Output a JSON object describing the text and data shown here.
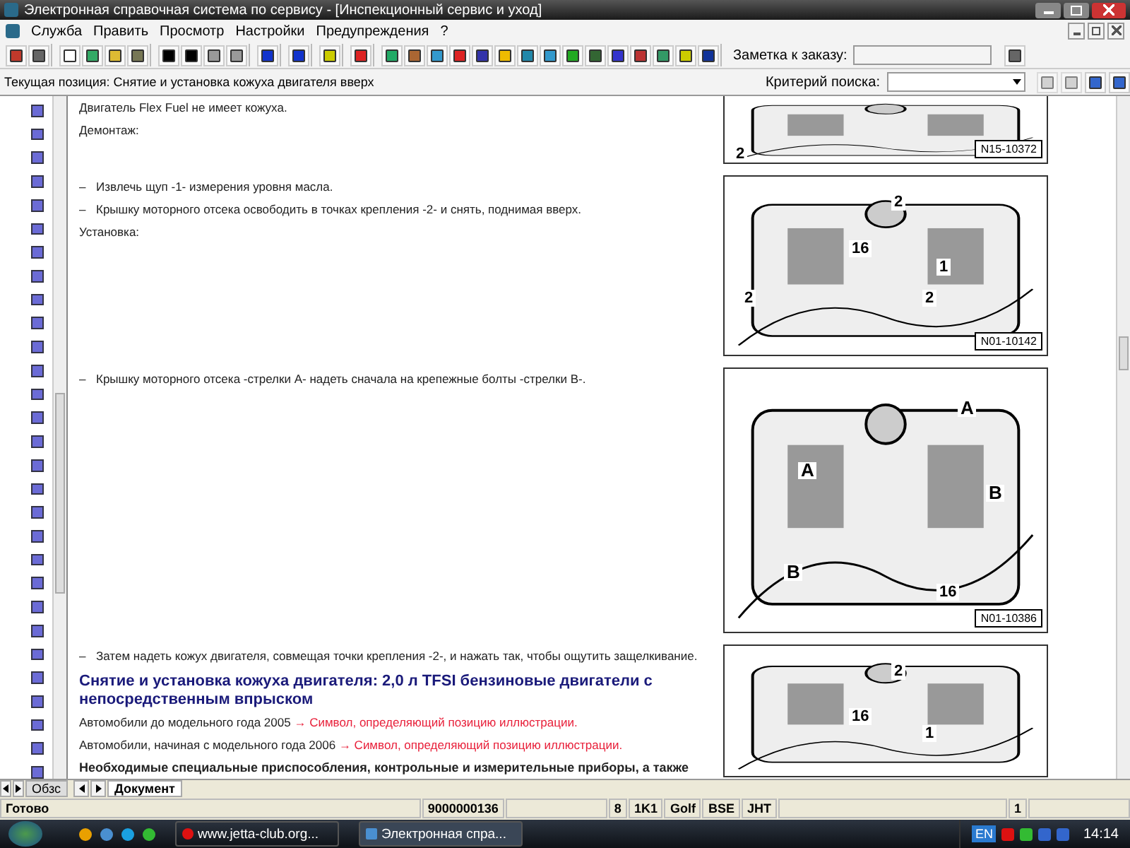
{
  "window": {
    "title": "Электронная справочная система по сервису - [Инспекционный сервис и уход]"
  },
  "menu": [
    "Служба",
    "Править",
    "Просмотр",
    "Настройки",
    "Предупреждения",
    "?"
  ],
  "order_note": {
    "label": "Заметка к заказу:"
  },
  "position": "Текущая позиция: Снятие и установка кожуха двигателя вверх",
  "search": {
    "label": "Критерий поиска:"
  },
  "sections": [
    {
      "blocks": [
        {
          "kind": "text",
          "text": "Двигатель Flex Fuel не имеет кожуха."
        },
        {
          "kind": "text",
          "text": "Демонтаж:"
        }
      ],
      "figure": {
        "code": "N15-10372",
        "callouts": [
          "2"
        ]
      }
    },
    {
      "blocks": [
        {
          "kind": "step",
          "bullet": "–",
          "text": "Извлечь щуп -1- измерения уровня масла."
        },
        {
          "kind": "step",
          "bullet": "–",
          "text": "Крышку моторного отсека освободить в точках крепления -2- и снять, поднимая вверх."
        },
        {
          "kind": "text",
          "text": "Установка:"
        }
      ],
      "figure": {
        "code": "N01-10142",
        "callouts": [
          "2",
          "1",
          "2",
          "2",
          "16"
        ]
      }
    },
    {
      "blocks": [
        {
          "kind": "step",
          "bullet": "–",
          "text": "Крышку моторного отсека -стрелки А- надеть сначала на крепежные болты -стрелки В-."
        }
      ],
      "figure": {
        "code": "N01-10386",
        "callouts": [
          "A",
          "A",
          "B",
          "B",
          "16"
        ]
      }
    },
    {
      "blocks": [
        {
          "kind": "step",
          "bullet": "–",
          "text": "Затем надеть кожух двигателя, совмещая точки крепления -2-, и нажать так, чтобы ощутить защелкивание."
        },
        {
          "kind": "heading",
          "text": "Снятие и установка кожуха двигателя: 2,0 л TFSI бензиновые двигатели с непосредственным впрыском"
        },
        {
          "kind": "link",
          "text": "Автомобили до модельного года 2005",
          "link": "→ Символ, определяющий позицию иллюстрации."
        },
        {
          "kind": "link",
          "text": "Автомобили, начиная с модельного года 2006",
          "link": "→ Символ, определяющий позицию иллюстрации."
        },
        {
          "kind": "bold",
          "text": "Необходимые специальные приспособления, контрольные и измерительные приборы, а также"
        }
      ],
      "figure": {
        "callouts": [
          "2",
          "1",
          "16"
        ]
      }
    }
  ],
  "tabs": [
    {
      "label": "Обзс",
      "selected": false
    },
    {
      "label": "Документ",
      "selected": true
    }
  ],
  "status_bar": {
    "text": "Готово",
    "order": "9000000136",
    "fields": [
      "8",
      "1K1",
      "Golf",
      "BSE",
      "JHT",
      "1"
    ]
  },
  "taskbar": {
    "tasks": [
      {
        "label": "www.jetta-club.org...",
        "selected": false
      },
      {
        "label": "Электронная спра...",
        "selected": true
      }
    ],
    "language": "EN",
    "clock": "14:14"
  }
}
